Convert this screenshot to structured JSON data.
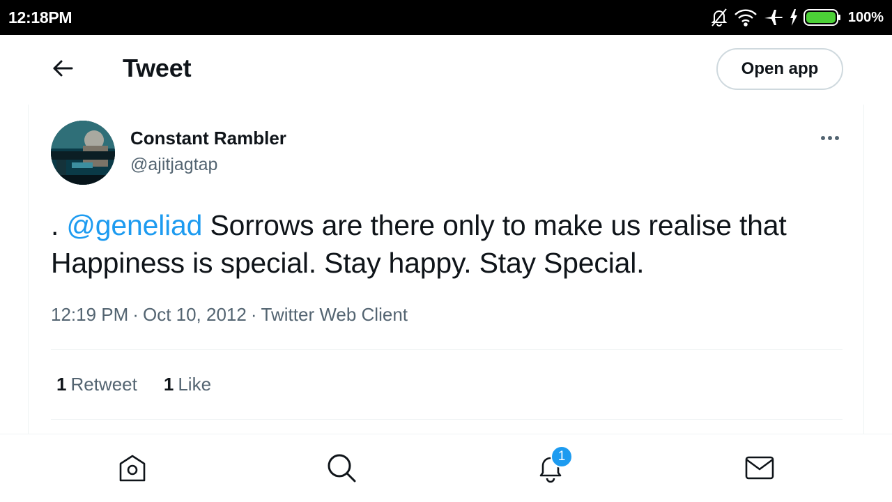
{
  "status_bar": {
    "time": "12:18PM",
    "battery_percent": "100%",
    "icons": [
      "bell-off-icon",
      "wifi-icon",
      "airplane-icon",
      "charging-bolt-icon",
      "battery-icon"
    ]
  },
  "header": {
    "title": "Tweet",
    "open_app_label": "Open app",
    "back_icon": "arrow-left-icon"
  },
  "tweet": {
    "author_name": "Constant Rambler",
    "author_handle": "@ajitjagtap",
    "text_prefix": ". ",
    "mention": "@geneliad",
    "text_body": " Sorrows are there only to make us realise that Happiness is special. Stay happy. Stay Special.",
    "time": "12:19 PM",
    "date": "Oct 10, 2012",
    "separator": "·",
    "source": "Twitter Web Client",
    "retweet_count": "1",
    "retweet_label": "Retweet",
    "like_count": "1",
    "like_label": "Like"
  },
  "bottom_nav": {
    "items": [
      "home-icon",
      "search-icon",
      "notifications-icon",
      "messages-icon"
    ],
    "notification_badge": "1"
  },
  "colors": {
    "accent": "#1d9bf0",
    "text_primary": "#0f1419",
    "text_secondary": "#536471",
    "border": "#eff3f4",
    "battery": "#4cd137"
  }
}
